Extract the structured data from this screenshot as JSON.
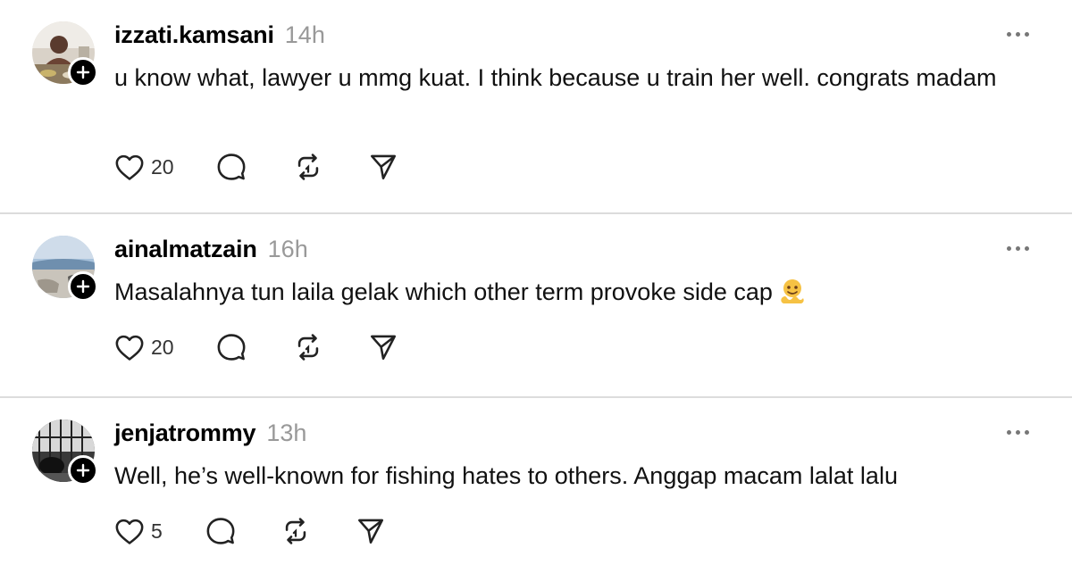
{
  "posts": [
    {
      "username": "izzati.kamsani",
      "time": "14h",
      "text": "u know what, lawyer u mmg kuat. I think because u train her well. congrats madam",
      "likes": "20"
    },
    {
      "username": "ainalmatzain",
      "time": "16h",
      "text": "Masalahnya tun laila gelak which other term provoke side cap",
      "emoji_icon": "melting-face-icon",
      "likes": "20"
    },
    {
      "username": "jenjatrommy",
      "time": "13h",
      "text": "Well, he’s well-known for fishing hates to others. Anggap macam lalat lalu",
      "likes": "5"
    }
  ],
  "icons": {
    "like": "heart-icon",
    "reply": "comment-icon",
    "repost": "repost-icon",
    "share": "send-icon",
    "more": "more-icon",
    "follow": "plus-icon"
  }
}
